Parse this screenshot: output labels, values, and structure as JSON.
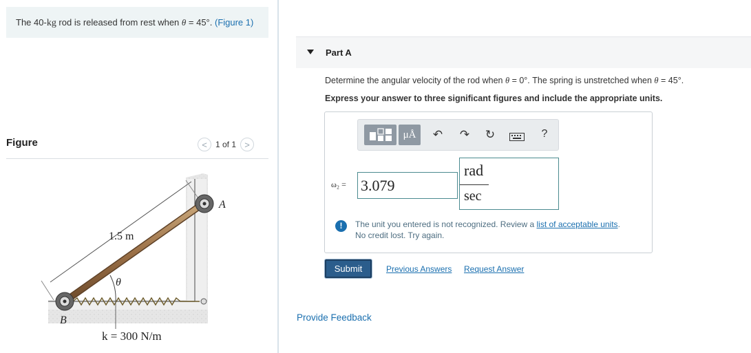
{
  "problem": {
    "text_before_mass": "The 40-",
    "mass_unit": "kg",
    "text_after_mass": " rod is released from rest when ",
    "theta": "θ",
    "text_after_theta": " = 45°. ",
    "figure_link": "(Figure 1)"
  },
  "figure_panel": {
    "title": "Figure",
    "nav_prev": "<",
    "nav_next": ">",
    "counter": "1 of 1"
  },
  "figure": {
    "label_length": "1.5 m",
    "label_theta": "θ",
    "label_A": "A",
    "label_B": "B",
    "label_spring": "k = 300 N/m"
  },
  "part": {
    "label": "Part A",
    "question_pre": "Determine the angular velocity of the rod when ",
    "theta": "θ",
    "question_mid": " = 0°. The spring is unstretched when ",
    "question_post": " = 45°.",
    "instructions": "Express your answer to three significant figures and include the appropriate units."
  },
  "toolbar": {
    "units_label": "μÅ",
    "undo_icon": "↶",
    "redo_icon": "↷",
    "reset_icon": "↻",
    "help_label": "?"
  },
  "answer": {
    "variable_label": "ω₂ =",
    "value": "3.079",
    "unit_numerator": "rad",
    "unit_denominator": "sec"
  },
  "error": {
    "icon": "!",
    "text_pre": "The unit you entered is not recognized. Review a ",
    "link": "list of acceptable units",
    "text_post": ".",
    "line2": "No credit lost. Try again."
  },
  "actions": {
    "submit": "Submit",
    "previous_answers": "Previous Answers",
    "request_answer": "Request Answer",
    "provide_feedback": "Provide Feedback"
  },
  "colors": {
    "link": "#1a6faf",
    "submit_bg": "#2b5d8c",
    "problem_bg": "#eef4f5"
  }
}
